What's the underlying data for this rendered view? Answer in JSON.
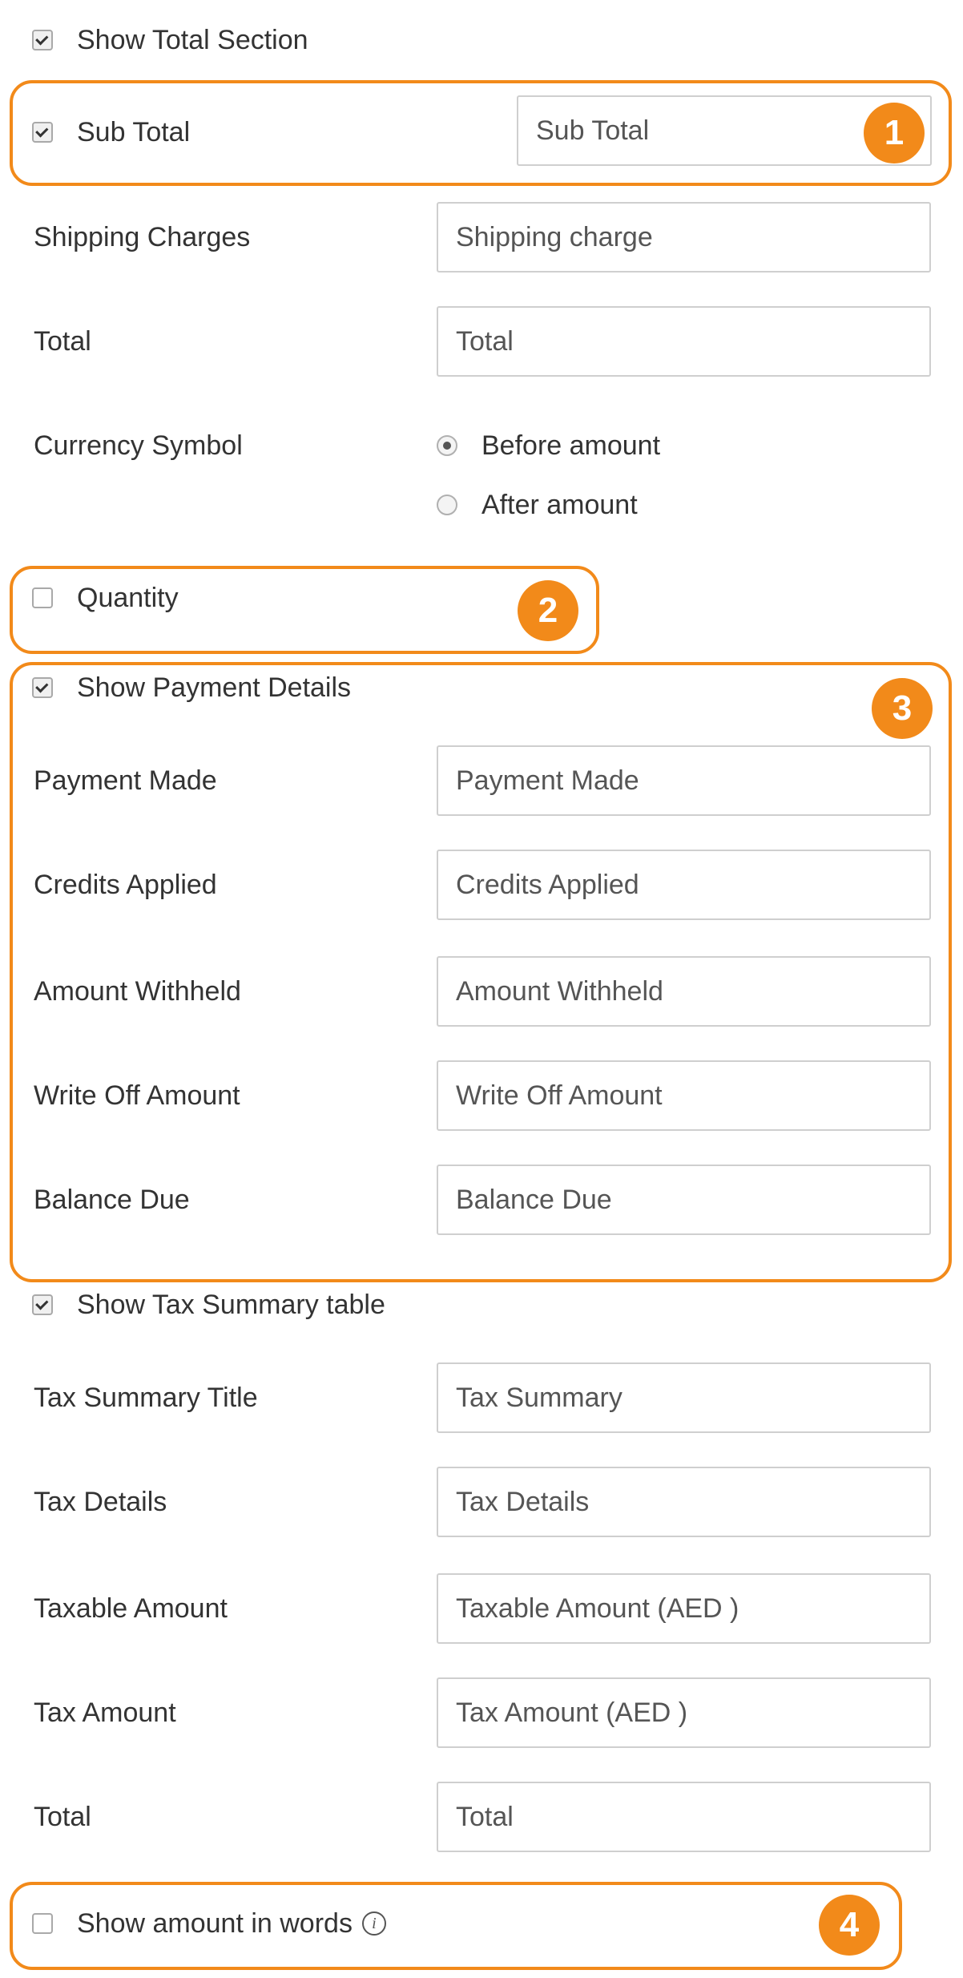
{
  "total_section": {
    "show_label": "Show Total Section",
    "show_checked": true,
    "sub_total": {
      "label": "Sub Total",
      "checked": true,
      "value": "Sub Total"
    },
    "shipping": {
      "label": "Shipping Charges",
      "value": "Shipping charge"
    },
    "total": {
      "label": "Total",
      "value": "Total"
    },
    "currency_symbol": {
      "label": "Currency Symbol",
      "options": [
        "Before amount",
        "After amount"
      ],
      "selected": "Before amount"
    }
  },
  "quantity": {
    "label": "Quantity",
    "checked": false
  },
  "payment_details": {
    "show_label": "Show Payment Details",
    "show_checked": true,
    "payment_made": {
      "label": "Payment Made",
      "value": "Payment Made"
    },
    "credits_applied": {
      "label": "Credits Applied",
      "value": "Credits Applied"
    },
    "amount_withheld": {
      "label": "Amount Withheld",
      "value": "Amount Withheld"
    },
    "write_off": {
      "label": "Write Off Amount",
      "value": "Write Off Amount"
    },
    "balance_due": {
      "label": "Balance Due",
      "value": "Balance Due"
    }
  },
  "tax_summary": {
    "show_label": "Show Tax Summary table",
    "show_checked": true,
    "title": {
      "label": "Tax Summary Title",
      "value": "Tax Summary"
    },
    "details": {
      "label": "Tax Details",
      "value": "Tax Details"
    },
    "taxable_amount": {
      "label": "Taxable Amount",
      "value": "Taxable Amount (AED )"
    },
    "tax_amount": {
      "label": "Tax Amount",
      "value": "Tax Amount (AED )"
    },
    "total": {
      "label": "Total",
      "value": "Total"
    }
  },
  "amount_in_words": {
    "label": "Show amount in words",
    "checked": false,
    "info_icon": "info-icon"
  },
  "callouts": [
    "1",
    "2",
    "3",
    "4"
  ],
  "accent_color": "#f28a1a"
}
